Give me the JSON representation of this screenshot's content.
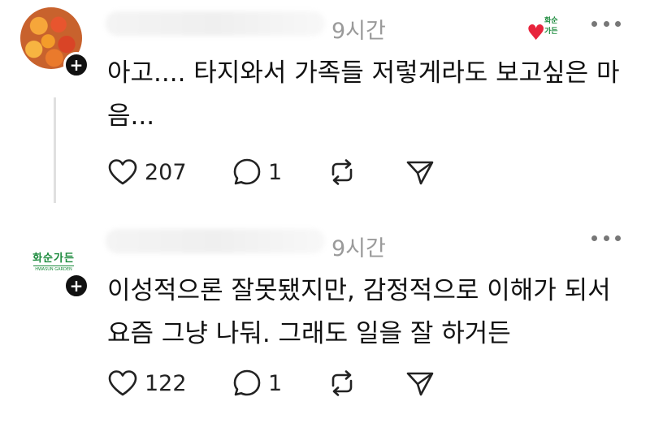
{
  "posts": [
    {
      "timestamp": "9시간",
      "body": "아고.... 타지와서 가족들 저렇게라도 보고싶은 마음...",
      "likes": "207",
      "replies": "1",
      "liked_by_author_label": "화순가든"
    },
    {
      "timestamp": "9시간",
      "avatar_text": "화순가든",
      "avatar_subtext": "HWASUN GARDEN",
      "body_line1": "이성적으론 잘못됐지만, 감정적으로 이해가 되서",
      "body_line2": "요즘 그냥 나둬. 그래도 일을 잘 하거든",
      "likes": "122",
      "replies": "1"
    }
  ],
  "icons": {
    "follow": "plus-icon",
    "more": "more-icon",
    "like": "heart-outline-icon",
    "reply": "comment-icon",
    "repost": "repost-icon",
    "share": "send-icon",
    "author_liked": "heart-filled-icon"
  },
  "colors": {
    "accent_heart": "#e8243c",
    "brand_green": "#1b8a3c",
    "muted_text": "#9a9a9a"
  }
}
